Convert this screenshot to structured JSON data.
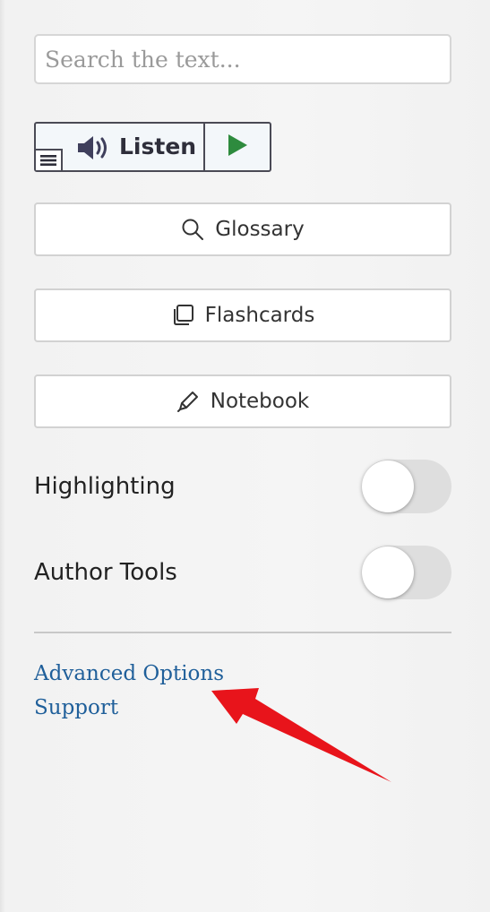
{
  "search": {
    "placeholder": "Search the text..."
  },
  "listen": {
    "label": "Listen",
    "menu_icon": "hamburger-icon",
    "speaker_icon": "speaker-icon",
    "play_icon": "play-icon",
    "play_color": "#2e8b3e"
  },
  "tools": [
    {
      "label": "Glossary",
      "icon": "search-icon"
    },
    {
      "label": "Flashcards",
      "icon": "cards-icon"
    },
    {
      "label": "Notebook",
      "icon": "pen-icon"
    }
  ],
  "toggles": [
    {
      "label": "Highlighting",
      "state": "off"
    },
    {
      "label": "Author Tools",
      "state": "off"
    }
  ],
  "links": [
    {
      "label": "Advanced Options"
    },
    {
      "label": "Support"
    }
  ],
  "annotation": {
    "type": "arrow",
    "color": "#e8141b",
    "points_to": "Advanced Options"
  },
  "colors": {
    "link": "#1f5f9a",
    "toggle_off": "#dedede"
  }
}
